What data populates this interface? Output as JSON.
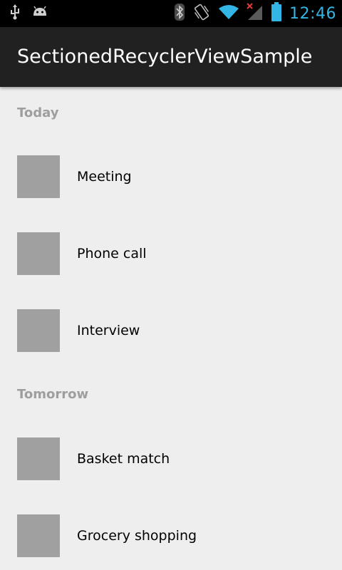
{
  "status_bar": {
    "time": "12:46",
    "left_icons": [
      "usb-icon",
      "android-debug-icon"
    ],
    "right_icons": [
      "bluetooth-icon",
      "vibrate-icon",
      "wifi-icon",
      "signal-no-service-icon",
      "battery-icon"
    ],
    "clock_color": "#33b5e5"
  },
  "app_bar": {
    "title": "SectionedRecyclerViewSample",
    "background": "#212121"
  },
  "sections": [
    {
      "header": "Today",
      "items": [
        "Meeting",
        "Phone call",
        "Interview"
      ]
    },
    {
      "header": "Tomorrow",
      "items": [
        "Basket match",
        "Grocery shopping"
      ]
    }
  ],
  "colors": {
    "background": "#eeeeee",
    "section_header": "#9e9e9e",
    "thumbnail": "#a0a0a0"
  }
}
